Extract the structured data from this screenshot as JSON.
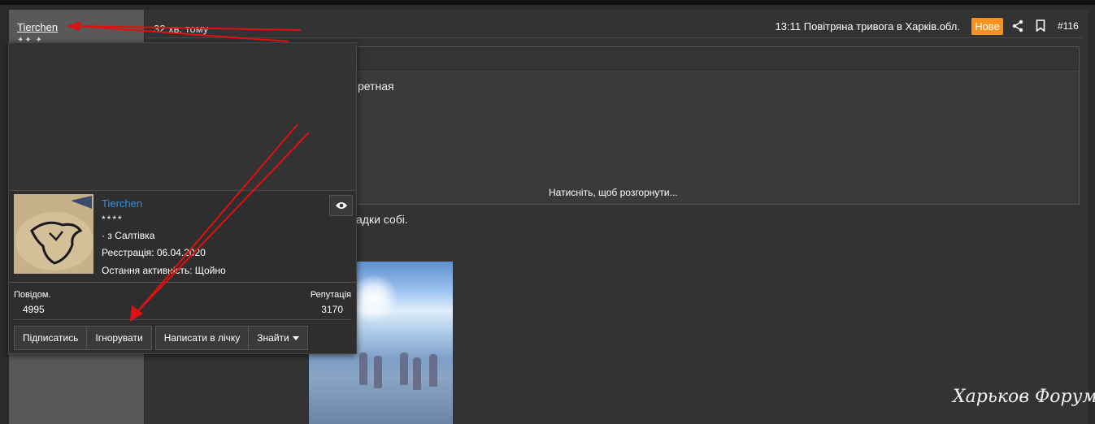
{
  "post": {
    "author": "Tierchen",
    "time": "32 хв. тому",
    "alert_title": "13:11 Повітряна тривога в Харків.обл.",
    "new_badge": "Нове",
    "share_icon": "share-icon",
    "bookmark_icon": "bookmark-icon",
    "number": "#116",
    "quote_text": "ретная",
    "expand_label": "Натисніть, щоб розгорнути...",
    "body_text": "адки собі."
  },
  "member_card": {
    "name": "Tierchen",
    "stars": "****",
    "location": "· з Салтівка",
    "registered": "Реєстрація: 06.04.2020",
    "last_activity": "Остання активність: Щойно",
    "watch_icon": "eye-icon",
    "messages_label": "Повідом.",
    "messages_value": "4995",
    "reputation_label": "Репутація",
    "reputation_value": "3170",
    "buttons": {
      "subscribe": "Підписатись",
      "ignore": "Ігнорувати",
      "message": "Написати в лічку",
      "find": "Знайти"
    }
  },
  "watermark": "Харьков Форум",
  "colors": {
    "accent": "#f7931e",
    "link": "#3a8fd6",
    "annotation_arrow": "#e01010"
  }
}
